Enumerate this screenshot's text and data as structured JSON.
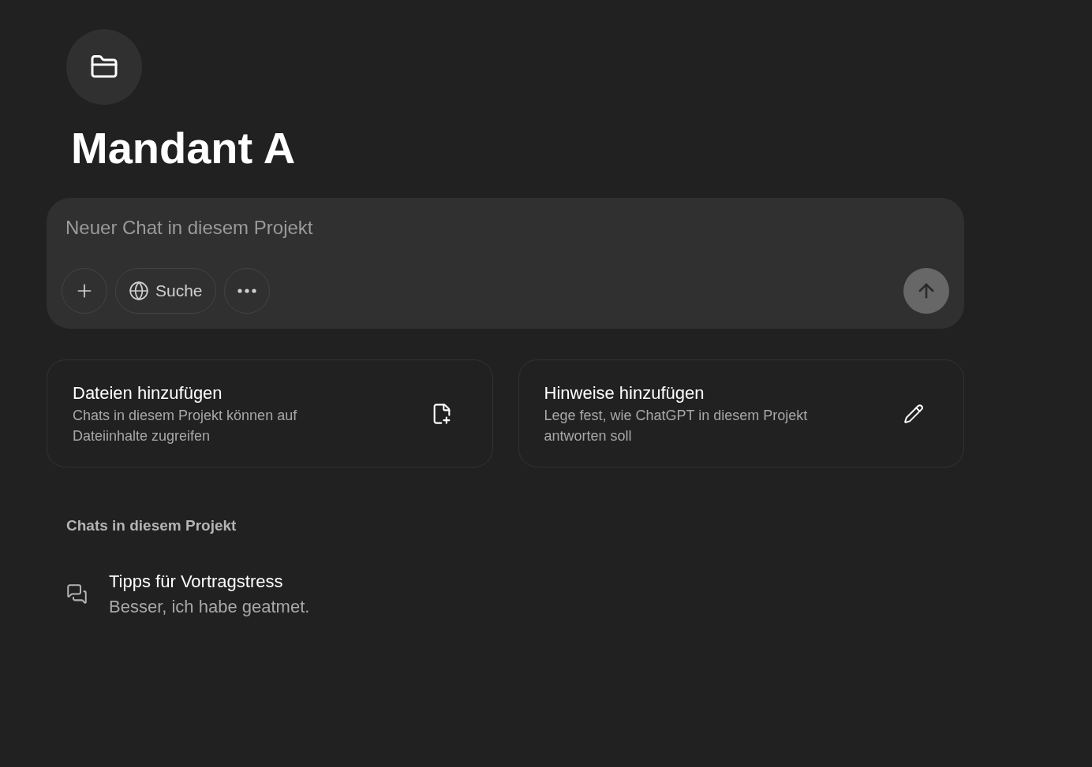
{
  "project": {
    "title": "Mandant A"
  },
  "composer": {
    "placeholder": "Neuer Chat in diesem Projekt",
    "send_disabled": true,
    "tools": [
      {
        "kind": "add"
      },
      {
        "kind": "search",
        "label": "Suche"
      },
      {
        "kind": "more"
      }
    ]
  },
  "cards": [
    {
      "kind": "files",
      "title": "Dateien hinzufügen",
      "description": "Chats in diesem Projekt können auf Dateiinhalte zugreifen"
    },
    {
      "kind": "instructions",
      "title": "Hinweise hinzufügen",
      "description": "Lege fest, wie ChatGPT in diesem Projekt antworten soll"
    }
  ],
  "chats_section": {
    "heading": "Chats in diesem Projekt",
    "chats": [
      {
        "title": "Tipps für Vortragstress",
        "preview": "Besser, ich habe geatmet."
      }
    ]
  }
}
